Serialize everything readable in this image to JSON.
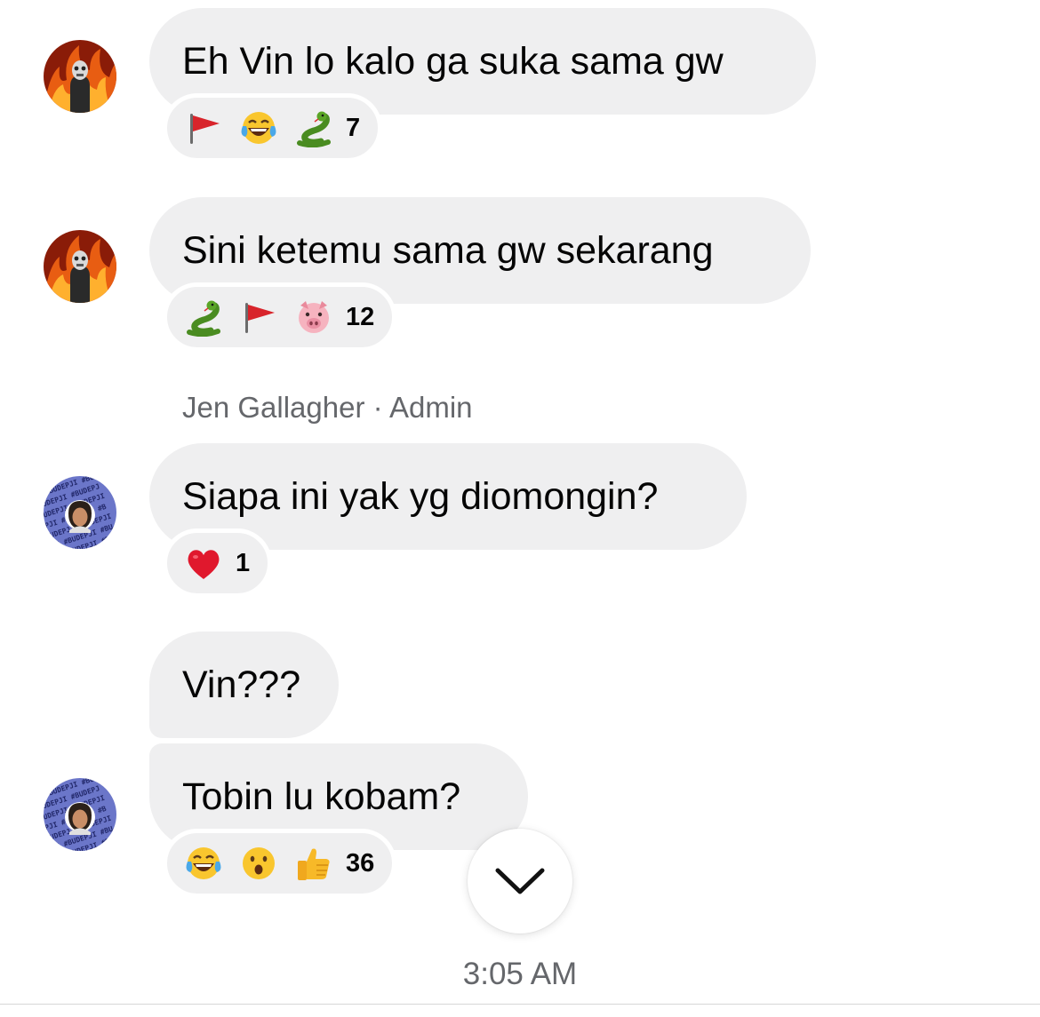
{
  "messages": [
    {
      "text": "Eh Vin lo kalo ga suka sama gw",
      "avatar": "fire-skull-avatar",
      "reactions": [
        "red-flag-emoji",
        "tears-of-joy-emoji",
        "snake-emoji"
      ],
      "count": "7"
    },
    {
      "text": "Sini ketemu sama gw sekarang",
      "avatar": "fire-skull-avatar",
      "reactions": [
        "snake-emoji",
        "red-flag-emoji",
        "pig-face-emoji"
      ],
      "count": "12"
    },
    {
      "sender": "Jen Gallagher · Admin",
      "text": "Siapa ini yak yg diomongin?",
      "avatar": "budepji-avatar",
      "reactions": [
        "red-heart-emoji"
      ],
      "count": "1"
    },
    {
      "text": "Vin???"
    },
    {
      "text": "Tobin lu kobam?",
      "avatar": "budepji-avatar",
      "reactions": [
        "tears-of-joy-emoji",
        "surprised-face-emoji",
        "thumbs-up-emoji"
      ],
      "count": "36"
    }
  ],
  "scroll_button": {
    "icon": "chevron-down-icon"
  },
  "timestamp": "3:05 AM"
}
